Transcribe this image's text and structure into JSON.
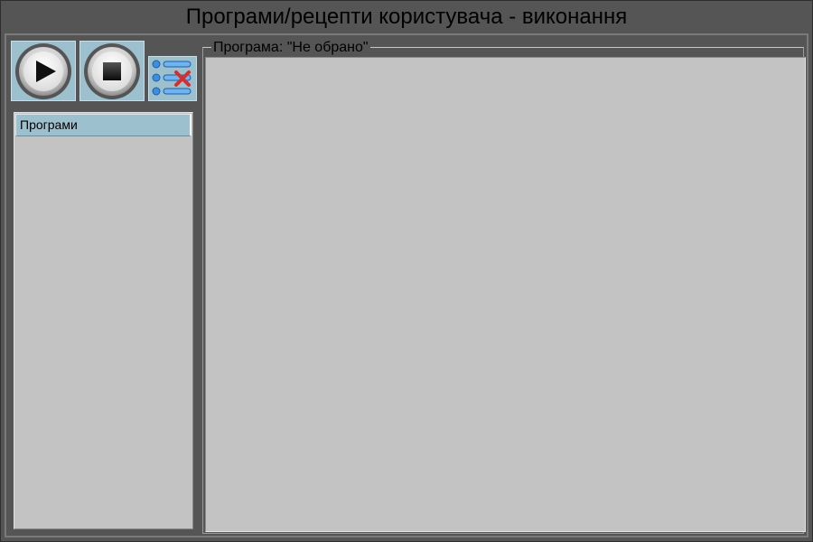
{
  "window": {
    "title": "Програми/рецепти користувача - виконання"
  },
  "toolbar": {
    "play_icon": "play-icon",
    "stop_icon": "stop-icon",
    "clear_list_icon": "list-clear-icon"
  },
  "program_list": {
    "header": "Програми",
    "items": []
  },
  "program_panel": {
    "title": "Програма: \"Не обрано\""
  },
  "colors": {
    "background": "#555555",
    "button_face": "#9dc0cf",
    "panel_face": "#c3c3c3",
    "clear_accent": "#d32f2f",
    "list_icon_blue": "#3c8fe0"
  }
}
